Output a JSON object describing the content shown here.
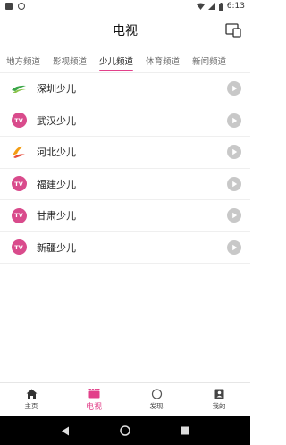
{
  "status_bar": {
    "time": "6:13"
  },
  "header": {
    "title": "电视",
    "action_icon": "screen-cast-icon"
  },
  "tabs": [
    {
      "label": "地方频道"
    },
    {
      "label": "影视频道"
    },
    {
      "label": "少儿频道",
      "active": true
    },
    {
      "label": "体育频道"
    },
    {
      "label": "新闻频道"
    }
  ],
  "channels": [
    {
      "name": "深圳少儿",
      "logo": "shenzhen-logo-icon"
    },
    {
      "name": "武汉少儿",
      "logo": "tv-badge-icon",
      "badge": "TV"
    },
    {
      "name": "河北少儿",
      "logo": "hebei-logo-icon"
    },
    {
      "name": "福建少儿",
      "logo": "tv-badge-icon",
      "badge": "TV"
    },
    {
      "name": "甘肃少儿",
      "logo": "tv-badge-icon",
      "badge": "TV"
    },
    {
      "name": "新疆少儿",
      "logo": "tv-badge-icon",
      "badge": "TV"
    }
  ],
  "bottom_nav": [
    {
      "label": "主页",
      "icon": "home-icon"
    },
    {
      "label": "电视",
      "icon": "clapperboard-icon",
      "active": true
    },
    {
      "label": "发现",
      "icon": "discover-icon"
    },
    {
      "label": "我的",
      "icon": "profile-icon"
    }
  ],
  "colors": {
    "accent": "#e2408a",
    "tv_badge": "#d94b8c",
    "play_icon": "#c8c8c8"
  }
}
